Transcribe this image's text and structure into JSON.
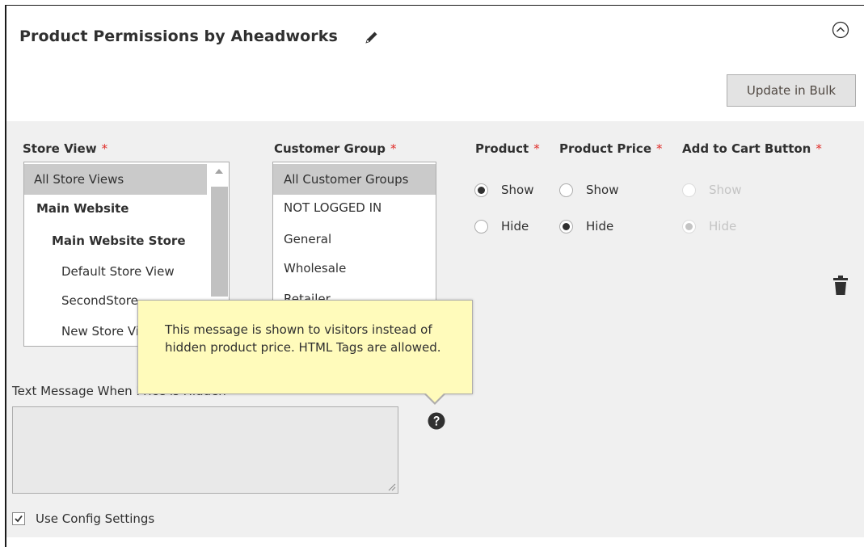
{
  "header": {
    "title": "Product Permissions by Aheadworks",
    "bulk_button_label": "Update in Bulk"
  },
  "store_view": {
    "label": "Store View",
    "required_mark": "*",
    "options": [
      {
        "label": "All Store Views",
        "selected": true,
        "bold": false,
        "indent": 0
      },
      {
        "label": "Main Website",
        "selected": false,
        "bold": true,
        "indent": 1
      },
      {
        "label": "Main Website Store",
        "selected": false,
        "bold": true,
        "indent": 2
      },
      {
        "label": "Default Store View",
        "selected": false,
        "bold": false,
        "indent": 3
      },
      {
        "label": "SecondStore",
        "selected": false,
        "bold": false,
        "indent": 3
      },
      {
        "label": "New Store View",
        "selected": false,
        "bold": false,
        "indent": 3
      }
    ]
  },
  "customer_group": {
    "label": "Customer Group",
    "required_mark": "*",
    "options": [
      {
        "label": "All Customer Groups",
        "selected": true
      },
      {
        "label": "NOT LOGGED IN",
        "selected": false
      },
      {
        "label": "General",
        "selected": false
      },
      {
        "label": "Wholesale",
        "selected": false
      },
      {
        "label": "Retailer",
        "selected": false
      }
    ]
  },
  "product": {
    "label": "Product",
    "required_mark": "*",
    "show_label": "Show",
    "hide_label": "Hide",
    "value": "Show"
  },
  "product_price": {
    "label": "Product Price",
    "required_mark": "*",
    "show_label": "Show",
    "hide_label": "Hide",
    "value": "Hide"
  },
  "add_to_cart": {
    "label": "Add to Cart Button",
    "required_mark": "*",
    "show_label": "Show",
    "hide_label": "Hide",
    "value": "Hide",
    "disabled": true
  },
  "text_message": {
    "label": "Text Message When Price is Hidden",
    "value": ""
  },
  "use_config": {
    "label": "Use Config Settings",
    "checked": true
  },
  "tooltip": {
    "text": "This message is shown to visitors instead of hidden product price. HTML Tags are allowed."
  },
  "icons": {
    "edit": "pencil-icon",
    "collapse": "collapse-circle-icon",
    "delete": "trash-icon",
    "help": "help-icon"
  },
  "colors": {
    "required": "#e02b27",
    "panel": "#f0f0f0",
    "selected_option": "#cacaca",
    "tooltip_bg": "#fffbbb"
  }
}
